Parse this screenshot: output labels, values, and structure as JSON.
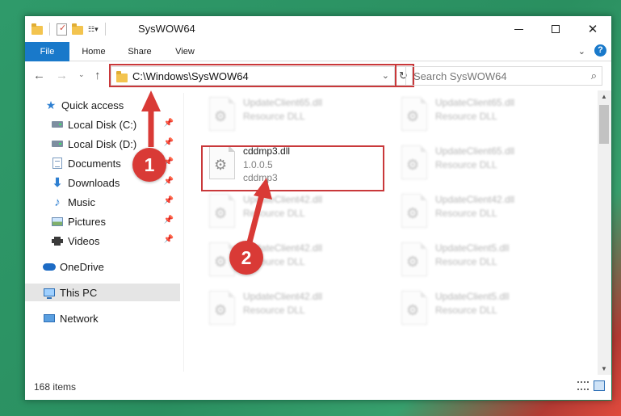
{
  "window": {
    "title": "SysWOW64",
    "controls": {
      "minimize": "",
      "maximize": "",
      "close": "✕"
    }
  },
  "ribbon": {
    "tabs": [
      "File",
      "Home",
      "Share",
      "View"
    ],
    "help": "?"
  },
  "address": {
    "path": "C:\\Windows\\SysWOW64",
    "refresh_icon": "refresh-icon"
  },
  "search": {
    "placeholder": "Search SysWOW64"
  },
  "sidebar": {
    "items": [
      {
        "label": "Quick access",
        "icon": "star-icon",
        "pinned": false
      },
      {
        "label": "Local Disk (C:)",
        "icon": "disk-icon",
        "pinned": true
      },
      {
        "label": "Local Disk (D:)",
        "icon": "disk-icon",
        "pinned": true
      },
      {
        "label": "Documents",
        "icon": "documents-icon",
        "pinned": true
      },
      {
        "label": "Downloads",
        "icon": "download-icon",
        "pinned": true
      },
      {
        "label": "Music",
        "icon": "music-icon",
        "pinned": true
      },
      {
        "label": "Pictures",
        "icon": "pictures-icon",
        "pinned": true
      },
      {
        "label": "Videos",
        "icon": "videos-icon",
        "pinned": true
      },
      {
        "label": "OneDrive",
        "icon": "onedrive-icon",
        "pinned": false
      },
      {
        "label": "This PC",
        "icon": "this-pc-icon",
        "pinned": false,
        "selected": true
      },
      {
        "label": "Network",
        "icon": "network-icon",
        "pinned": false
      }
    ]
  },
  "files": [
    {
      "name": "UpdateClient65.dll",
      "line2": "Resource DLL",
      "line3": "",
      "blurred": true
    },
    {
      "name": "UpdateClient65.dll",
      "line2": "Resource DLL",
      "line3": "",
      "blurred": true
    },
    {
      "name": "cddmp3.dll",
      "line2": "1.0.0.5",
      "line3": "cddmp3",
      "blurred": false
    },
    {
      "name": "UpdateClient65.dll",
      "line2": "Resource DLL",
      "line3": "",
      "blurred": true
    },
    {
      "name": "UpdateClient42.dll",
      "line2": "Resource DLL",
      "line3": "",
      "blurred": true
    },
    {
      "name": "UpdateClient42.dll",
      "line2": "Resource DLL",
      "line3": "",
      "blurred": true
    },
    {
      "name": "UpdateClient42.dll",
      "line2": "Resource DLL",
      "line3": "",
      "blurred": true
    },
    {
      "name": "UpdateClient5.dll",
      "line2": "Resource DLL",
      "line3": "",
      "blurred": true
    },
    {
      "name": "UpdateClient42.dll",
      "line2": "Resource DLL",
      "line3": "",
      "blurred": true
    },
    {
      "name": "UpdateClient5.dll",
      "line2": "Resource DLL",
      "line3": "",
      "blurred": true
    }
  ],
  "status": {
    "item_count": "168 items"
  },
  "annotations": {
    "step1": "1",
    "step2": "2",
    "color": "#d93a36"
  }
}
